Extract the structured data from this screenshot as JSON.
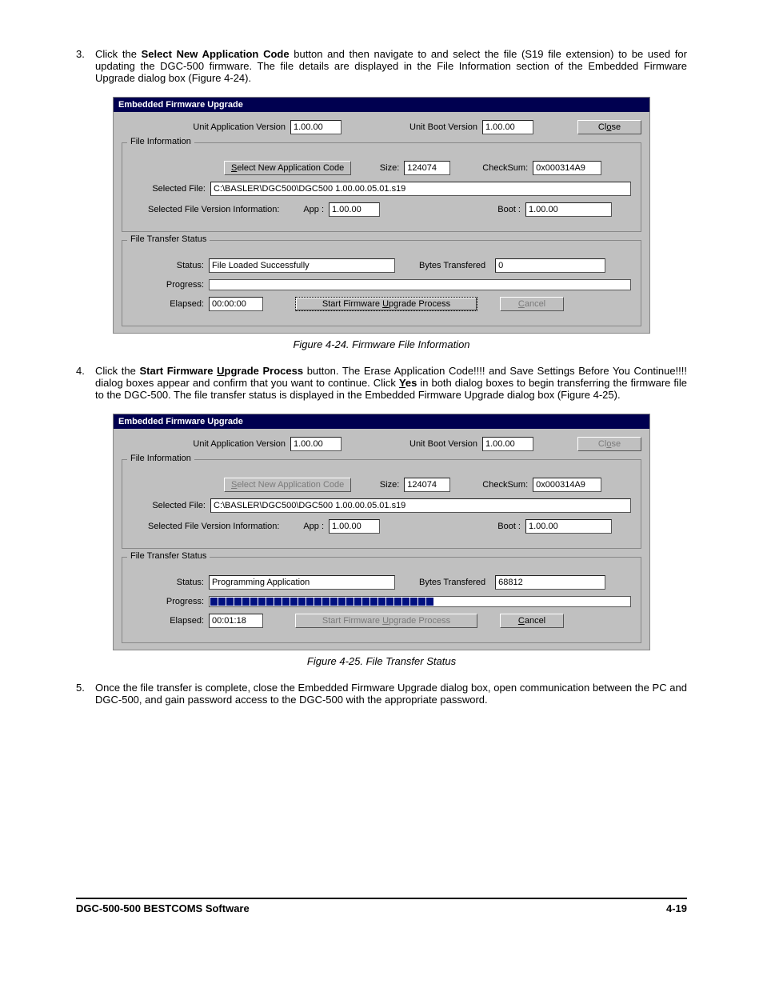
{
  "step3": {
    "num": "3.",
    "t1a": "Click the ",
    "t1b": "Select New Application Code",
    "t1c": " button and then navigate to and select the file (S19 file extension) to be used for updating the DGC-500 firmware. The file details are displayed in the File Information section of the Embedded Firmware Upgrade dialog box (Figure 4-24)."
  },
  "step4": {
    "num": "4.",
    "t1a": "Click the ",
    "t1b": "Start Firmware ",
    "t1b_u": "U",
    "t1b2": "pgrade Process",
    "t1c": " button. The Erase Application Code!!!! and Save Settings Before You Continue!!!! dialog boxes appear and confirm that you want to continue. Click ",
    "t1d_u": "Y",
    "t1d": "es",
    "t1e": " in both dialog boxes to begin transferring the firmware file to the DGC-500. The file transfer status is displayed in the Embedded Firmware Upgrade dialog box (Figure 4-25)."
  },
  "step5": {
    "num": "5.",
    "t": "Once the file transfer is complete, close the Embedded Firmware Upgrade dialog box, open communication between the PC and DGC-500, and gain password access to the DGC-500 with the appropriate password."
  },
  "caption1": "Figure 4-24. Firmware File Information",
  "caption2": "Figure 4-25. File Transfer Status",
  "dlg_title": "Embedded Firmware Upgrade",
  "labels": {
    "unit_app_ver": "Unit Application Version",
    "unit_boot_ver": "Unit Boot Version",
    "close": "Cl",
    "close_u": "o",
    "close2": "se",
    "file_info": "File Information",
    "select_new": "elect New Application Code",
    "select_new_u": "S",
    "size": "Size:",
    "checksum": "CheckSum:",
    "selected_file": "Selected File:",
    "sel_ver_info": "Selected File Version Information:",
    "app": "App :",
    "boot": "Boot :",
    "transfer_status": "File Transfer Status",
    "status": "Status:",
    "bytes": "Bytes Transfered",
    "progress": "Progress:",
    "elapsed": "Elapsed:",
    "start": "Start Firmware ",
    "start_u": "U",
    "start2": "pgrade Process",
    "cancel": "ancel",
    "cancel_u": "C"
  },
  "d1": {
    "app_ver": "1.00.00",
    "boot_ver": "1.00.00",
    "size": "124074",
    "checksum": "0x000314A9",
    "selected_file": "C:\\BASLER\\DGC500\\DGC500 1.00.00.05.01.s19",
    "file_app": "1.00.00",
    "file_boot": "1.00.00",
    "status": "File Loaded Successfully",
    "bytes": "0",
    "elapsed": "00:00:00",
    "close_enabled": true,
    "select_enabled": true,
    "start_enabled": true,
    "cancel_enabled": false,
    "progress_blocks": 0
  },
  "d2": {
    "app_ver": "1.00.00",
    "boot_ver": "1.00.00",
    "size": "124074",
    "checksum": "0x000314A9",
    "selected_file": "C:\\BASLER\\DGC500\\DGC500 1.00.00.05.01.s19",
    "file_app": "1.00.00",
    "file_boot": "1.00.00",
    "status": "Programming Application",
    "bytes": "68812",
    "elapsed": "00:01:18",
    "close_enabled": false,
    "select_enabled": false,
    "start_enabled": false,
    "cancel_enabled": true,
    "progress_blocks": 28
  },
  "footer": {
    "left": "DGC-500-500 BESTCOMS Software",
    "right": "4-19"
  }
}
